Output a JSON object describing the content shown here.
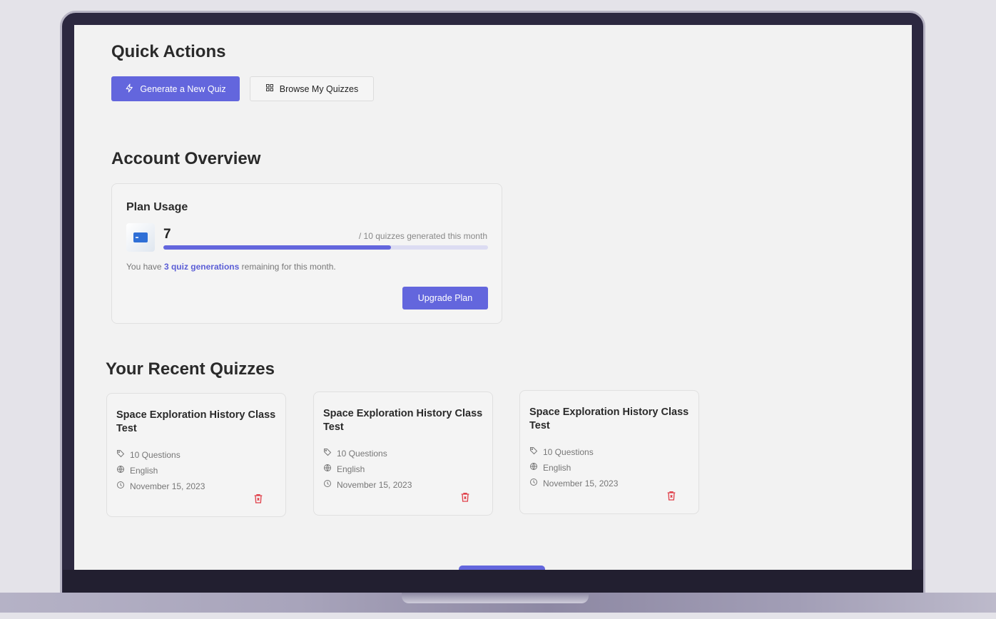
{
  "quick_actions": {
    "heading": "Quick Actions",
    "generate_label": "Generate a New Quiz",
    "browse_label": "Browse My Quizzes"
  },
  "account_overview": {
    "heading": "Account Overview",
    "plan_usage": {
      "title": "Plan Usage",
      "used": "7",
      "suffix": "/ 10 quizzes generated this month",
      "used_fraction": 0.7,
      "remaining_prefix": "You have",
      "remaining_highlight": "3 quiz generations",
      "remaining_suffix": "remaining for this month.",
      "upgrade_label": "Upgrade Plan"
    }
  },
  "recent_quizzes": {
    "heading": "Your Recent Quizzes",
    "items": [
      {
        "title": "Space Exploration History Class Test",
        "questions": "10 Questions",
        "language": "English",
        "date": "November 15, 2023"
      },
      {
        "title": "Space Exploration History Class Test",
        "questions": "10 Questions",
        "language": "English",
        "date": "November 15, 2023"
      },
      {
        "title": "Space Exploration History Class Test",
        "questions": "10 Questions",
        "language": "English",
        "date": "November 15, 2023"
      }
    ]
  },
  "colors": {
    "accent": "#6366dd",
    "danger": "#e0404a",
    "frame": "#2c2840"
  },
  "icons": {
    "generate": "lightning-icon",
    "browse": "grid-icon",
    "plan": "credit-card-icon",
    "questions": "tag-icon",
    "language": "globe-icon",
    "date": "clock-icon",
    "delete": "trash-icon"
  }
}
